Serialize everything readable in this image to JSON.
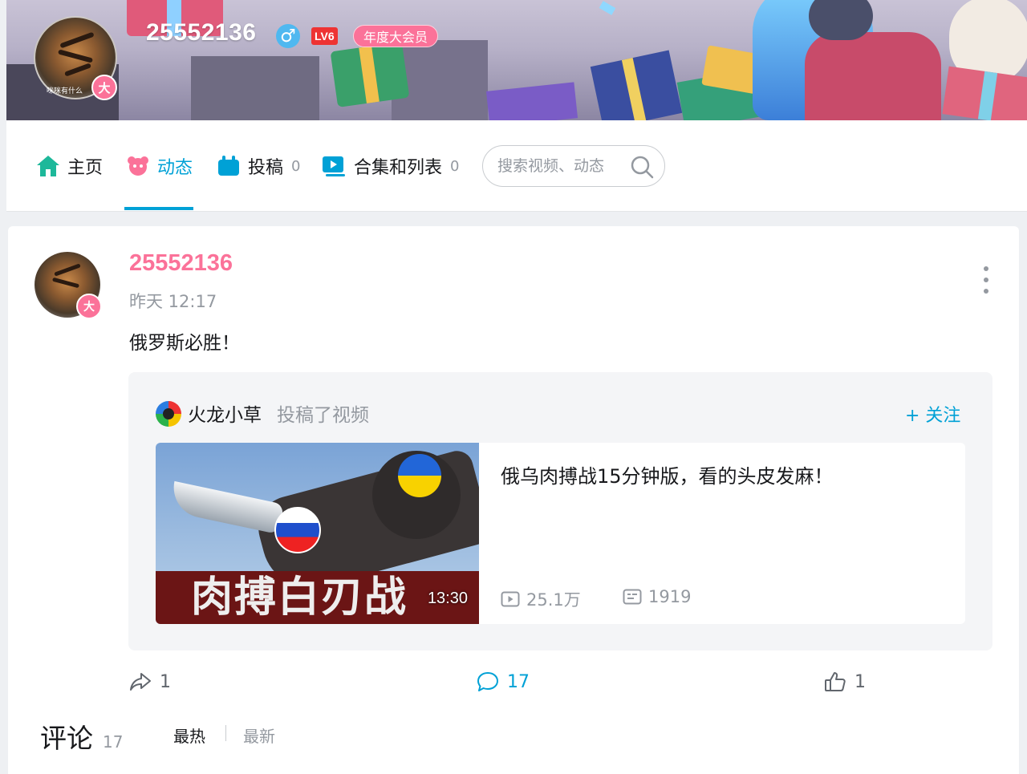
{
  "profile": {
    "username": "25552136",
    "level": "LV6",
    "vip_label": "年度大会员",
    "vip_badge": "大",
    "avatar_caption": "咪咪有什么"
  },
  "nav": {
    "items": [
      {
        "label": "主页",
        "count": ""
      },
      {
        "label": "动态",
        "count": ""
      },
      {
        "label": "投稿",
        "count": "0"
      },
      {
        "label": "合集和列表",
        "count": "0"
      }
    ],
    "active_index": 1,
    "search_placeholder": "搜索视频、动态"
  },
  "post": {
    "username": "25552136",
    "time": "昨天 12:17",
    "text": "俄罗斯必胜！",
    "vip_badge": "大",
    "forward": {
      "author": "火龙小草",
      "action": "投稿了视频",
      "follow_label": "+ 关注",
      "video": {
        "thumb_title": "肉搏白刃战",
        "duration": "13:30",
        "title": "俄乌肉搏战15分钟版，看的头皮发麻！",
        "views": "25.1万",
        "danmaku": "1919"
      }
    },
    "actions": {
      "share": "1",
      "comment": "17",
      "like": "1"
    }
  },
  "comments": {
    "title": "评论",
    "count": "17",
    "sort_hot": "最热",
    "sort_new": "最新"
  },
  "colors": {
    "accent": "#00a1d6",
    "vip_pink": "#fb7299",
    "muted": "#9499a0"
  }
}
